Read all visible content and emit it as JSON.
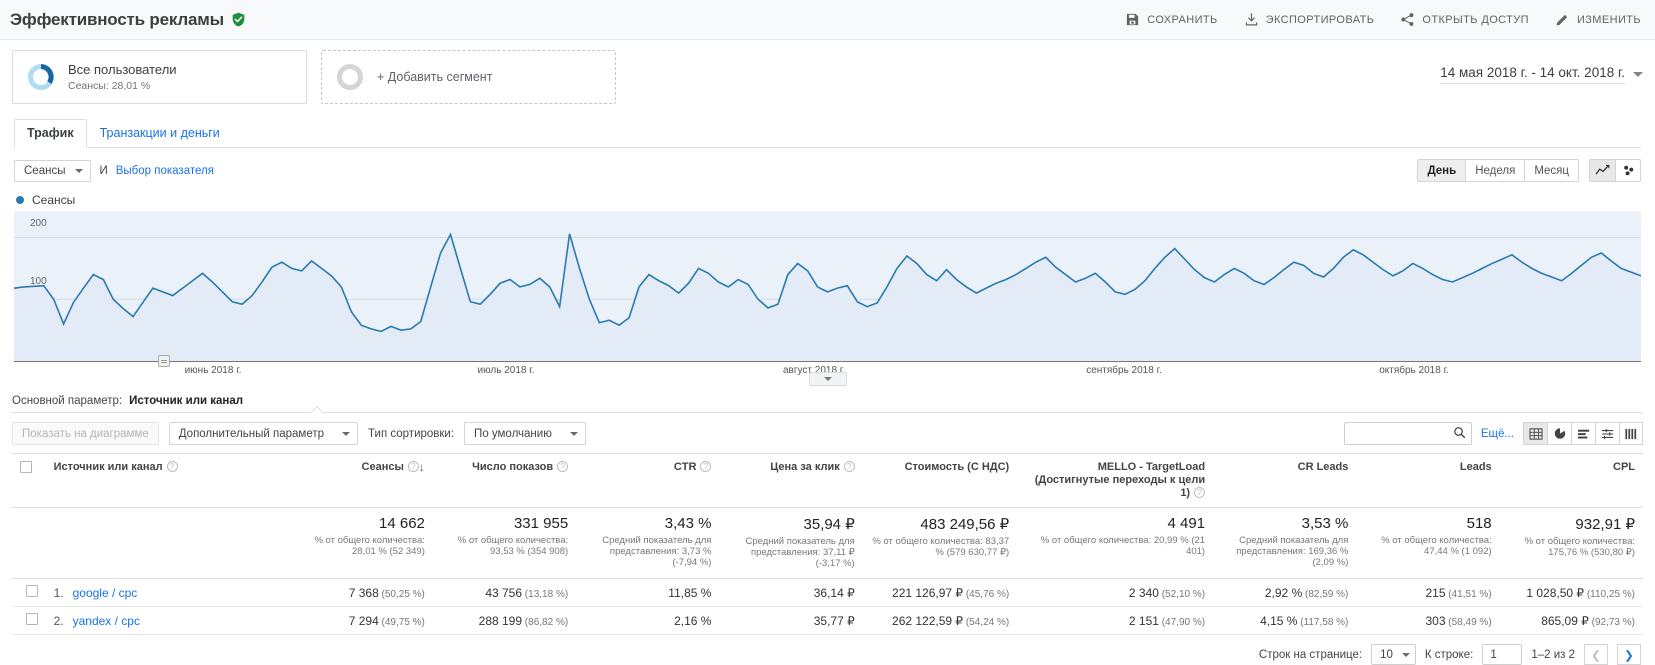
{
  "header": {
    "title": "Эффективность рекламы",
    "verified_icon": "verified-shield-icon",
    "actions": [
      {
        "icon": "save-icon",
        "label": "СОХРАНИТЬ"
      },
      {
        "icon": "export-icon",
        "label": "ЭКСПОРТИРОВАТЬ"
      },
      {
        "icon": "share-icon",
        "label": "ОТКРЫТЬ ДОСТУП"
      },
      {
        "icon": "edit-pencil-icon",
        "label": "ИЗМЕНИТЬ"
      }
    ]
  },
  "segments": {
    "all_users": {
      "name": "Все пользователи",
      "sub": "Сеансы: 28,01 %"
    },
    "add_segment": "+ Добавить сегмент"
  },
  "date_range": {
    "text": "14 мая 2018 г. - 14 окт. 2018 г."
  },
  "tabs": [
    {
      "label": "Трафик",
      "active": true
    },
    {
      "label": "Транзакции и деньги",
      "active": false
    }
  ],
  "metric_row": {
    "metric_select": "Сеансы",
    "and": "И",
    "select_metric_link": "Выбор показателя",
    "granularity": [
      {
        "label": "День",
        "active": true
      },
      {
        "label": "Неделя",
        "active": false
      },
      {
        "label": "Месяц",
        "active": false
      }
    ],
    "chart_type_icons": [
      "line-chart-icon",
      "scatter-chart-icon"
    ]
  },
  "chart_data": {
    "type": "line",
    "title": "",
    "legend": [
      "Сеансы"
    ],
    "legend_position": "top-left",
    "series_color": "#2a7ab0",
    "ylabel": "",
    "xlabel": "",
    "ylim": [
      0,
      230
    ],
    "yticks": [
      100,
      200
    ],
    "grid": true,
    "xticks": [
      "июнь 2018 г.",
      "июль 2018 г.",
      "август 2018 г.",
      "сентябрь 2018 г.",
      "октябрь 2018 г."
    ],
    "series": [
      {
        "name": "Сеансы",
        "values": [
          118,
          120,
          121,
          122,
          100,
          60,
          95,
          118,
          140,
          132,
          100,
          85,
          72,
          95,
          118,
          112,
          106,
          118,
          130,
          142,
          128,
          112,
          96,
          92,
          106,
          128,
          152,
          160,
          150,
          146,
          162,
          150,
          138,
          120,
          80,
          58,
          52,
          48,
          56,
          50,
          52,
          64,
          120,
          175,
          205,
          150,
          96,
          92,
          108,
          126,
          132,
          120,
          124,
          134,
          120,
          88,
          206,
          150,
          100,
          62,
          66,
          58,
          70,
          120,
          140,
          130,
          122,
          110,
          126,
          150,
          142,
          128,
          120,
          132,
          124,
          100,
          86,
          92,
          140,
          158,
          146,
          120,
          112,
          118,
          122,
          96,
          88,
          94,
          120,
          150,
          170,
          158,
          140,
          130,
          148,
          132,
          120,
          110,
          118,
          126,
          132,
          140,
          150,
          160,
          168,
          152,
          140,
          128,
          134,
          142,
          128,
          112,
          108,
          116,
          130,
          150,
          168,
          182,
          165,
          148,
          135,
          128,
          140,
          150,
          142,
          130,
          124,
          135,
          148,
          160,
          155,
          142,
          136,
          150,
          168,
          180,
          172,
          160,
          148,
          138,
          146,
          158,
          150,
          140,
          132,
          128,
          135,
          142,
          150,
          158,
          165,
          172,
          160,
          150,
          142,
          136,
          130,
          142,
          155,
          168,
          175,
          162,
          150,
          144,
          138
        ]
      }
    ]
  },
  "primary_dimension": {
    "label": "Основной параметр:",
    "value": "Источник или канал"
  },
  "table_controls": {
    "plot_rows_placeholder": "Показать на диаграмме",
    "secondary_dimension": "Дополнительный параметр",
    "sort_type_label": "Тип сортировки:",
    "sort_type_value": "По умолчанию",
    "search_icon": "search-icon",
    "more_link": "Ещё...",
    "view_icons": [
      "table-view-icon",
      "pie-view-icon",
      "bar-view-icon",
      "comparison-view-icon",
      "pivot-view-icon"
    ]
  },
  "table": {
    "columns": [
      {
        "label": "Источник или канал",
        "help": true,
        "align": "left"
      },
      {
        "label": "Сеансы",
        "help": true,
        "align": "right",
        "sorted": true
      },
      {
        "label": "Число показов",
        "help": true,
        "align": "right"
      },
      {
        "label": "CTR",
        "help": true,
        "align": "right"
      },
      {
        "label": "Цена за клик",
        "help": true,
        "align": "right"
      },
      {
        "label": "Стоимость (С НДС)",
        "help": false,
        "align": "right"
      },
      {
        "label": "MELLO - TargetLoad (Достигнутые переходы к цели 1)",
        "help": true,
        "align": "right"
      },
      {
        "label": "CR Leads",
        "help": false,
        "align": "right"
      },
      {
        "label": "Leads",
        "help": false,
        "align": "right"
      },
      {
        "label": "CPL",
        "help": false,
        "align": "right"
      }
    ],
    "totals": [
      {
        "main": "14 662",
        "sub": "% от общего количества: 28,01 % (52 349)"
      },
      {
        "main": "331 955",
        "sub": "% от общего количества: 93,53 % (354 908)"
      },
      {
        "main": "3,43 %",
        "sub": "Средний показатель для представления: 3,73 % (-7,94 %)"
      },
      {
        "main": "35,94 ₽",
        "sub": "Средний показатель для представления: 37,11 ₽ (-3,17 %)"
      },
      {
        "main": "483 249,56 ₽",
        "sub": "% от общего количества: 83,37 % (579 630,77 ₽)"
      },
      {
        "main": "4 491",
        "sub": "% от общего количества: 20,99 % (21 401)"
      },
      {
        "main": "3,53 %",
        "sub": "Средний показатель для представления: 169,36 % (2,09 %)"
      },
      {
        "main": "518",
        "sub": "% от общего количества: 47,44 % (1 092)"
      },
      {
        "main": "932,91 ₽",
        "sub": "% от общего количества: 175,76 % (530,80 ₽)"
      }
    ],
    "rows": [
      {
        "index": "1.",
        "source": "google / cpc",
        "cells": [
          {
            "v": "7 368",
            "p": "(50,25 %)"
          },
          {
            "v": "43 756",
            "p": "(13,18 %)"
          },
          {
            "v": "11,85 %",
            "p": ""
          },
          {
            "v": "36,14 ₽",
            "p": ""
          },
          {
            "v": "221 126,97 ₽",
            "p": "(45,76 %)"
          },
          {
            "v": "2 340",
            "p": "(52,10 %)"
          },
          {
            "v": "2,92 %",
            "p": "(82,59 %)"
          },
          {
            "v": "215",
            "p": "(41,51 %)"
          },
          {
            "v": "1 028,50 ₽",
            "p": "(110,25 %)"
          }
        ]
      },
      {
        "index": "2.",
        "source": "yandex / cpc",
        "cells": [
          {
            "v": "7 294",
            "p": "(49,75 %)"
          },
          {
            "v": "288 199",
            "p": "(86,82 %)"
          },
          {
            "v": "2,16 %",
            "p": ""
          },
          {
            "v": "35,77 ₽",
            "p": ""
          },
          {
            "v": "262 122,59 ₽",
            "p": "(54,24 %)"
          },
          {
            "v": "2 151",
            "p": "(47,90 %)"
          },
          {
            "v": "4,15 %",
            "p": "(117,58 %)"
          },
          {
            "v": "303",
            "p": "(58,49 %)"
          },
          {
            "v": "865,09 ₽",
            "p": "(92,73 %)"
          }
        ]
      }
    ]
  },
  "pager": {
    "rows_label": "Строк на странице:",
    "rows_value": "10",
    "goto_label": "К строке:",
    "goto_value": "1",
    "range_text": "1–2 из 2",
    "prev_icon": "chevron-left-icon",
    "next_icon": "chevron-right-icon"
  }
}
